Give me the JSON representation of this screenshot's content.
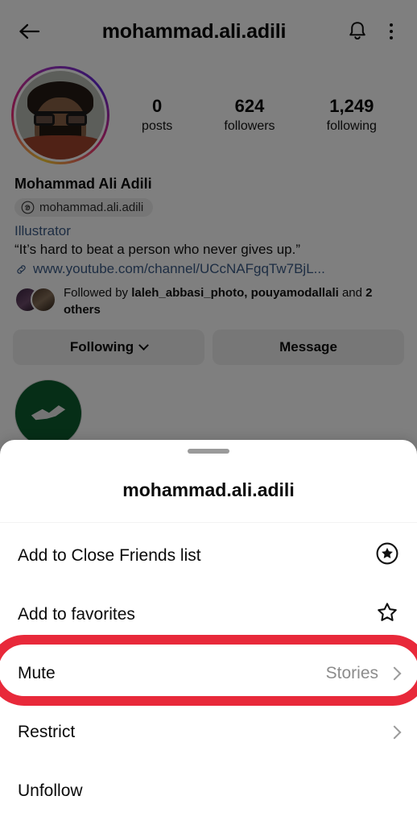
{
  "header": {
    "back_icon": "back-arrow-icon",
    "title": "mohammad.ali.adili",
    "bell_icon": "bell-icon",
    "menu_icon": "kebab-menu-icon"
  },
  "profile": {
    "avatar_icon": "profile-avatar",
    "stats": [
      {
        "value": "0",
        "label": "posts"
      },
      {
        "value": "624",
        "label": "followers"
      },
      {
        "value": "1,249",
        "label": "following"
      }
    ],
    "full_name": "Mohammad Ali Adili",
    "threads_icon": "threads-icon",
    "threads_handle": "mohammad.ali.adili",
    "category": "Illustrator",
    "quote": "“It’s hard to beat a person who never gives up.”",
    "link_icon": "link-icon",
    "link_text": "www.youtube.com/channel/UCcNAFgqTw7BjL...",
    "followed_by_prefix": "Followed by ",
    "followed_by_names": "laleh_abbasi_photo, pouyamodallali",
    "followed_by_middle": " and ",
    "followed_by_others": "2 others",
    "buttons": [
      {
        "label": "Following",
        "has_chevron": true
      },
      {
        "label": "Message",
        "has_chevron": false
      }
    ],
    "highlight_icon": "story-highlight-circle"
  },
  "sheet": {
    "grabber_icon": "drag-handle",
    "title": "mohammad.ali.adili",
    "items": [
      {
        "label": "Add to Close Friends list",
        "value": "",
        "icon": "star-in-circle-icon",
        "highlighted": false
      },
      {
        "label": "Add to favorites",
        "value": "",
        "icon": "star-outline-icon",
        "highlighted": false
      },
      {
        "label": "Mute",
        "value": "Stories",
        "icon": "chevron-right-icon",
        "highlighted": true
      },
      {
        "label": "Restrict",
        "value": "",
        "icon": "chevron-right-icon",
        "highlighted": false
      },
      {
        "label": "Unfollow",
        "value": "",
        "icon": "",
        "highlighted": false
      }
    ]
  },
  "annotation": {
    "color": "#e8293a",
    "target": "Mute"
  },
  "colors": {
    "accent_blue": "#3a5a86",
    "overlay": "#7f7f7f",
    "annotation_red": "#e8293a",
    "button_gray": "#efefef"
  }
}
